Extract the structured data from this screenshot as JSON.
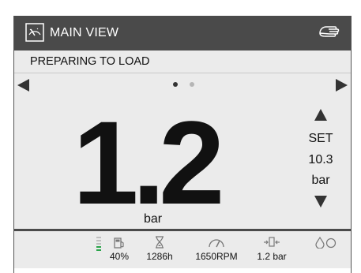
{
  "header": {
    "title": "MAIN VIEW",
    "view_icon": "gauge-frame-icon",
    "hand_icon": "hand-icon"
  },
  "status": {
    "text": "PREPARING TO LOAD"
  },
  "pager": {
    "page_count": 2,
    "current_page": 1
  },
  "main": {
    "value": "1.2",
    "unit": "bar"
  },
  "setpoint": {
    "label": "SET",
    "value": "10.3",
    "unit": "bar"
  },
  "footer": {
    "fuel": {
      "icon": "fuel-pump-icon",
      "label": "40%",
      "level_fraction": 0.4
    },
    "hours": {
      "icon": "hourglass-icon",
      "label": "1286h"
    },
    "rpm": {
      "icon": "tachometer-icon",
      "label": "1650RPM"
    },
    "pressure": {
      "icon": "valve-icon",
      "label": "1.2 bar"
    },
    "droplets": {
      "icon": "droplets-icon"
    }
  },
  "colors": {
    "header_bg": "#4a4a4a",
    "screen_bg": "#ebebeb",
    "fuel_level": "#2aa44a"
  }
}
